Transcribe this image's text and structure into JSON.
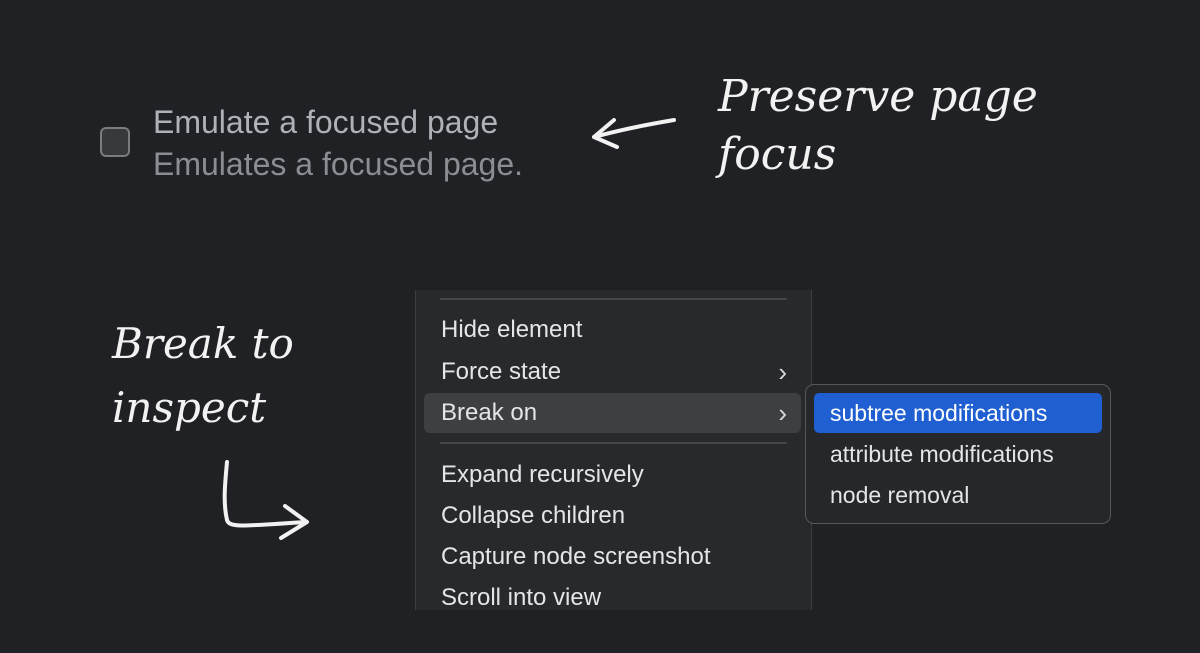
{
  "setting": {
    "title": "Emulate a focused page",
    "description": "Emulates a focused page.",
    "checked": false
  },
  "annotations": {
    "focus_note": [
      "Preserve page",
      "focus"
    ],
    "break_note": [
      "Break to",
      "inspect"
    ]
  },
  "context_menu": {
    "items": [
      {
        "label": "Hide element"
      },
      {
        "label": "Force state",
        "has_submenu": true
      },
      {
        "label": "Break on",
        "has_submenu": true,
        "highlighted": true
      },
      {
        "label": "Expand recursively"
      },
      {
        "label": "Collapse children"
      },
      {
        "label": "Capture node screenshot"
      },
      {
        "label": "Scroll into view"
      }
    ],
    "chevron": "›"
  },
  "submenu": {
    "items": [
      {
        "label": "subtree modifications",
        "selected": true
      },
      {
        "label": "attribute modifications"
      },
      {
        "label": "node removal"
      }
    ]
  },
  "colors": {
    "background": "#202124",
    "selection": "#1f5fd1",
    "annotation": "#f2f2f2"
  }
}
